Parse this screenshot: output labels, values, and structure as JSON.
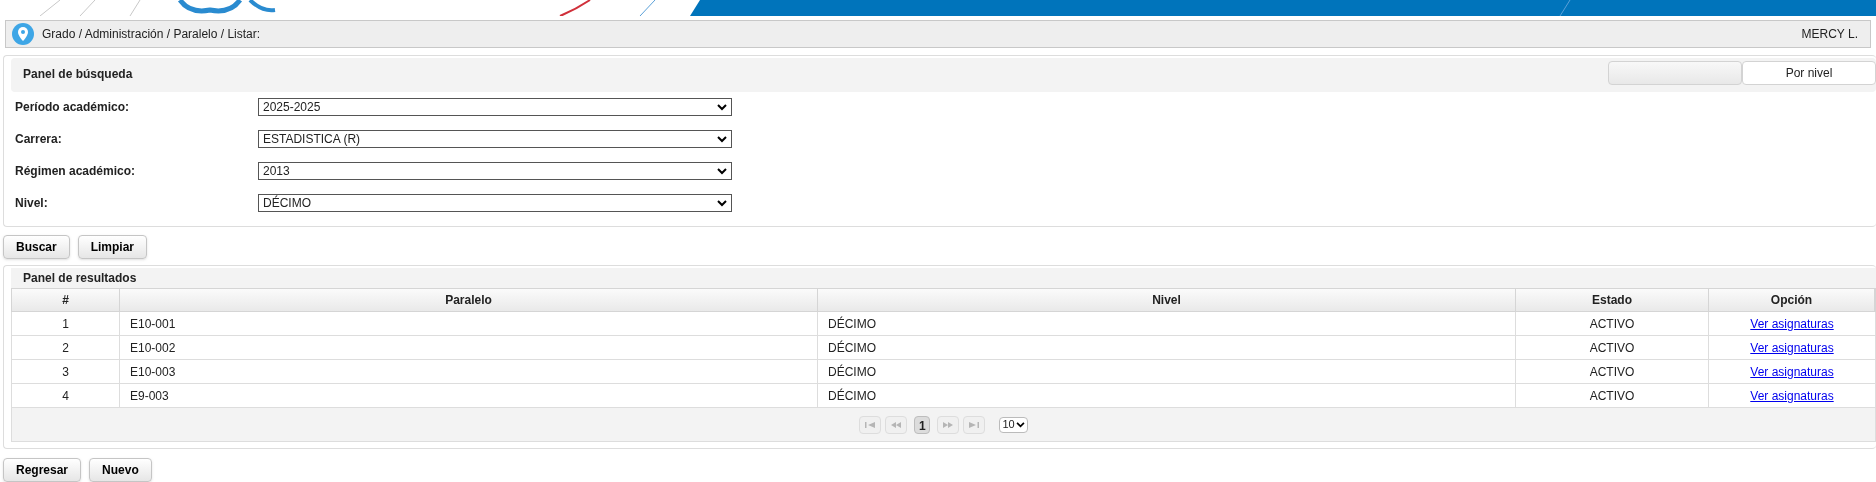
{
  "breadcrumb": "Grado / Administración / Paralelo / Listar:",
  "user": "MERCY L.",
  "search_panel": {
    "title": "Panel de búsqueda",
    "tabs": [
      {
        "selected": false
      },
      {
        "label": "Por nivel",
        "selected": true
      }
    ],
    "fields": [
      {
        "label": "Período académico:",
        "value": "2025-2025"
      },
      {
        "label": "Carrera:",
        "value": "ESTADISTICA (R)"
      },
      {
        "label": "Régimen académico:",
        "value": "2013"
      },
      {
        "label": "Nivel:",
        "value": "DÉCIMO"
      }
    ]
  },
  "search_buttons": [
    "Buscar",
    "Limpiar"
  ],
  "results_panel": {
    "title": "Panel de resultados",
    "columns": [
      "#",
      "Paralelo",
      "Nivel",
      "Estado",
      "Opción"
    ],
    "rows": [
      {
        "index": "1",
        "paralelo": "E10-001",
        "nivel": "DÉCIMO",
        "estado": "ACTIVO",
        "option": "Ver asignaturas"
      },
      {
        "index": "2",
        "paralelo": "E10-002",
        "nivel": "DÉCIMO",
        "estado": "ACTIVO",
        "option": "Ver asignaturas"
      },
      {
        "index": "3",
        "paralelo": "E10-003",
        "nivel": "DÉCIMO",
        "estado": "ACTIVO",
        "option": "Ver asignaturas"
      },
      {
        "index": "4",
        "paralelo": "E9-003",
        "nivel": "DÉCIMO",
        "estado": "ACTIVO",
        "option": "Ver asignaturas"
      }
    ],
    "pagination": {
      "pages": [
        {
          "label": "1",
          "selected": true
        }
      ],
      "page_size": "10"
    }
  },
  "bottom_buttons": [
    "Regresar",
    "Nuevo"
  ]
}
